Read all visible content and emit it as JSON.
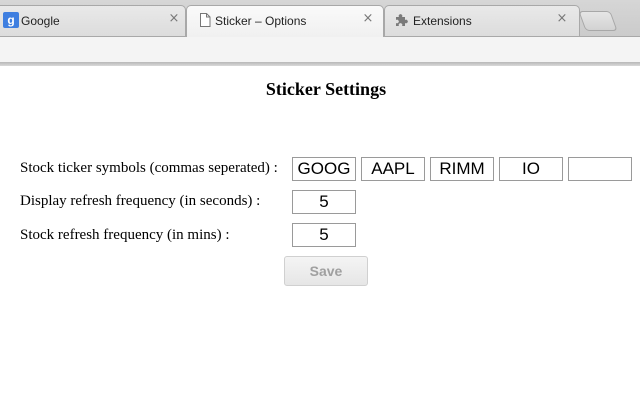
{
  "tabs": [
    {
      "title": "Google",
      "favicon": "google-g-icon",
      "favicon_text": "g",
      "close": "×"
    },
    {
      "title": "Sticker – Options",
      "favicon": "page-icon",
      "close": "×"
    },
    {
      "title": "Extensions",
      "favicon": "puzzle-piece-icon",
      "close": "×"
    }
  ],
  "page": {
    "title": "Sticker Settings",
    "ticker_label": "Stock ticker symbols (commas seperated) :",
    "tickers": [
      "GOOG",
      "AAPL",
      "RIMM",
      "IO",
      ""
    ],
    "display_refresh_label": "Display refresh frequency (in seconds) :",
    "display_refresh_value": "5",
    "stock_refresh_label": "Stock refresh frequency (in mins) :",
    "stock_refresh_value": "5",
    "save_label": "Save"
  },
  "colors": {
    "google_favicon": "#3f7fe0",
    "save_text_disabled": "#a0a0a0"
  }
}
